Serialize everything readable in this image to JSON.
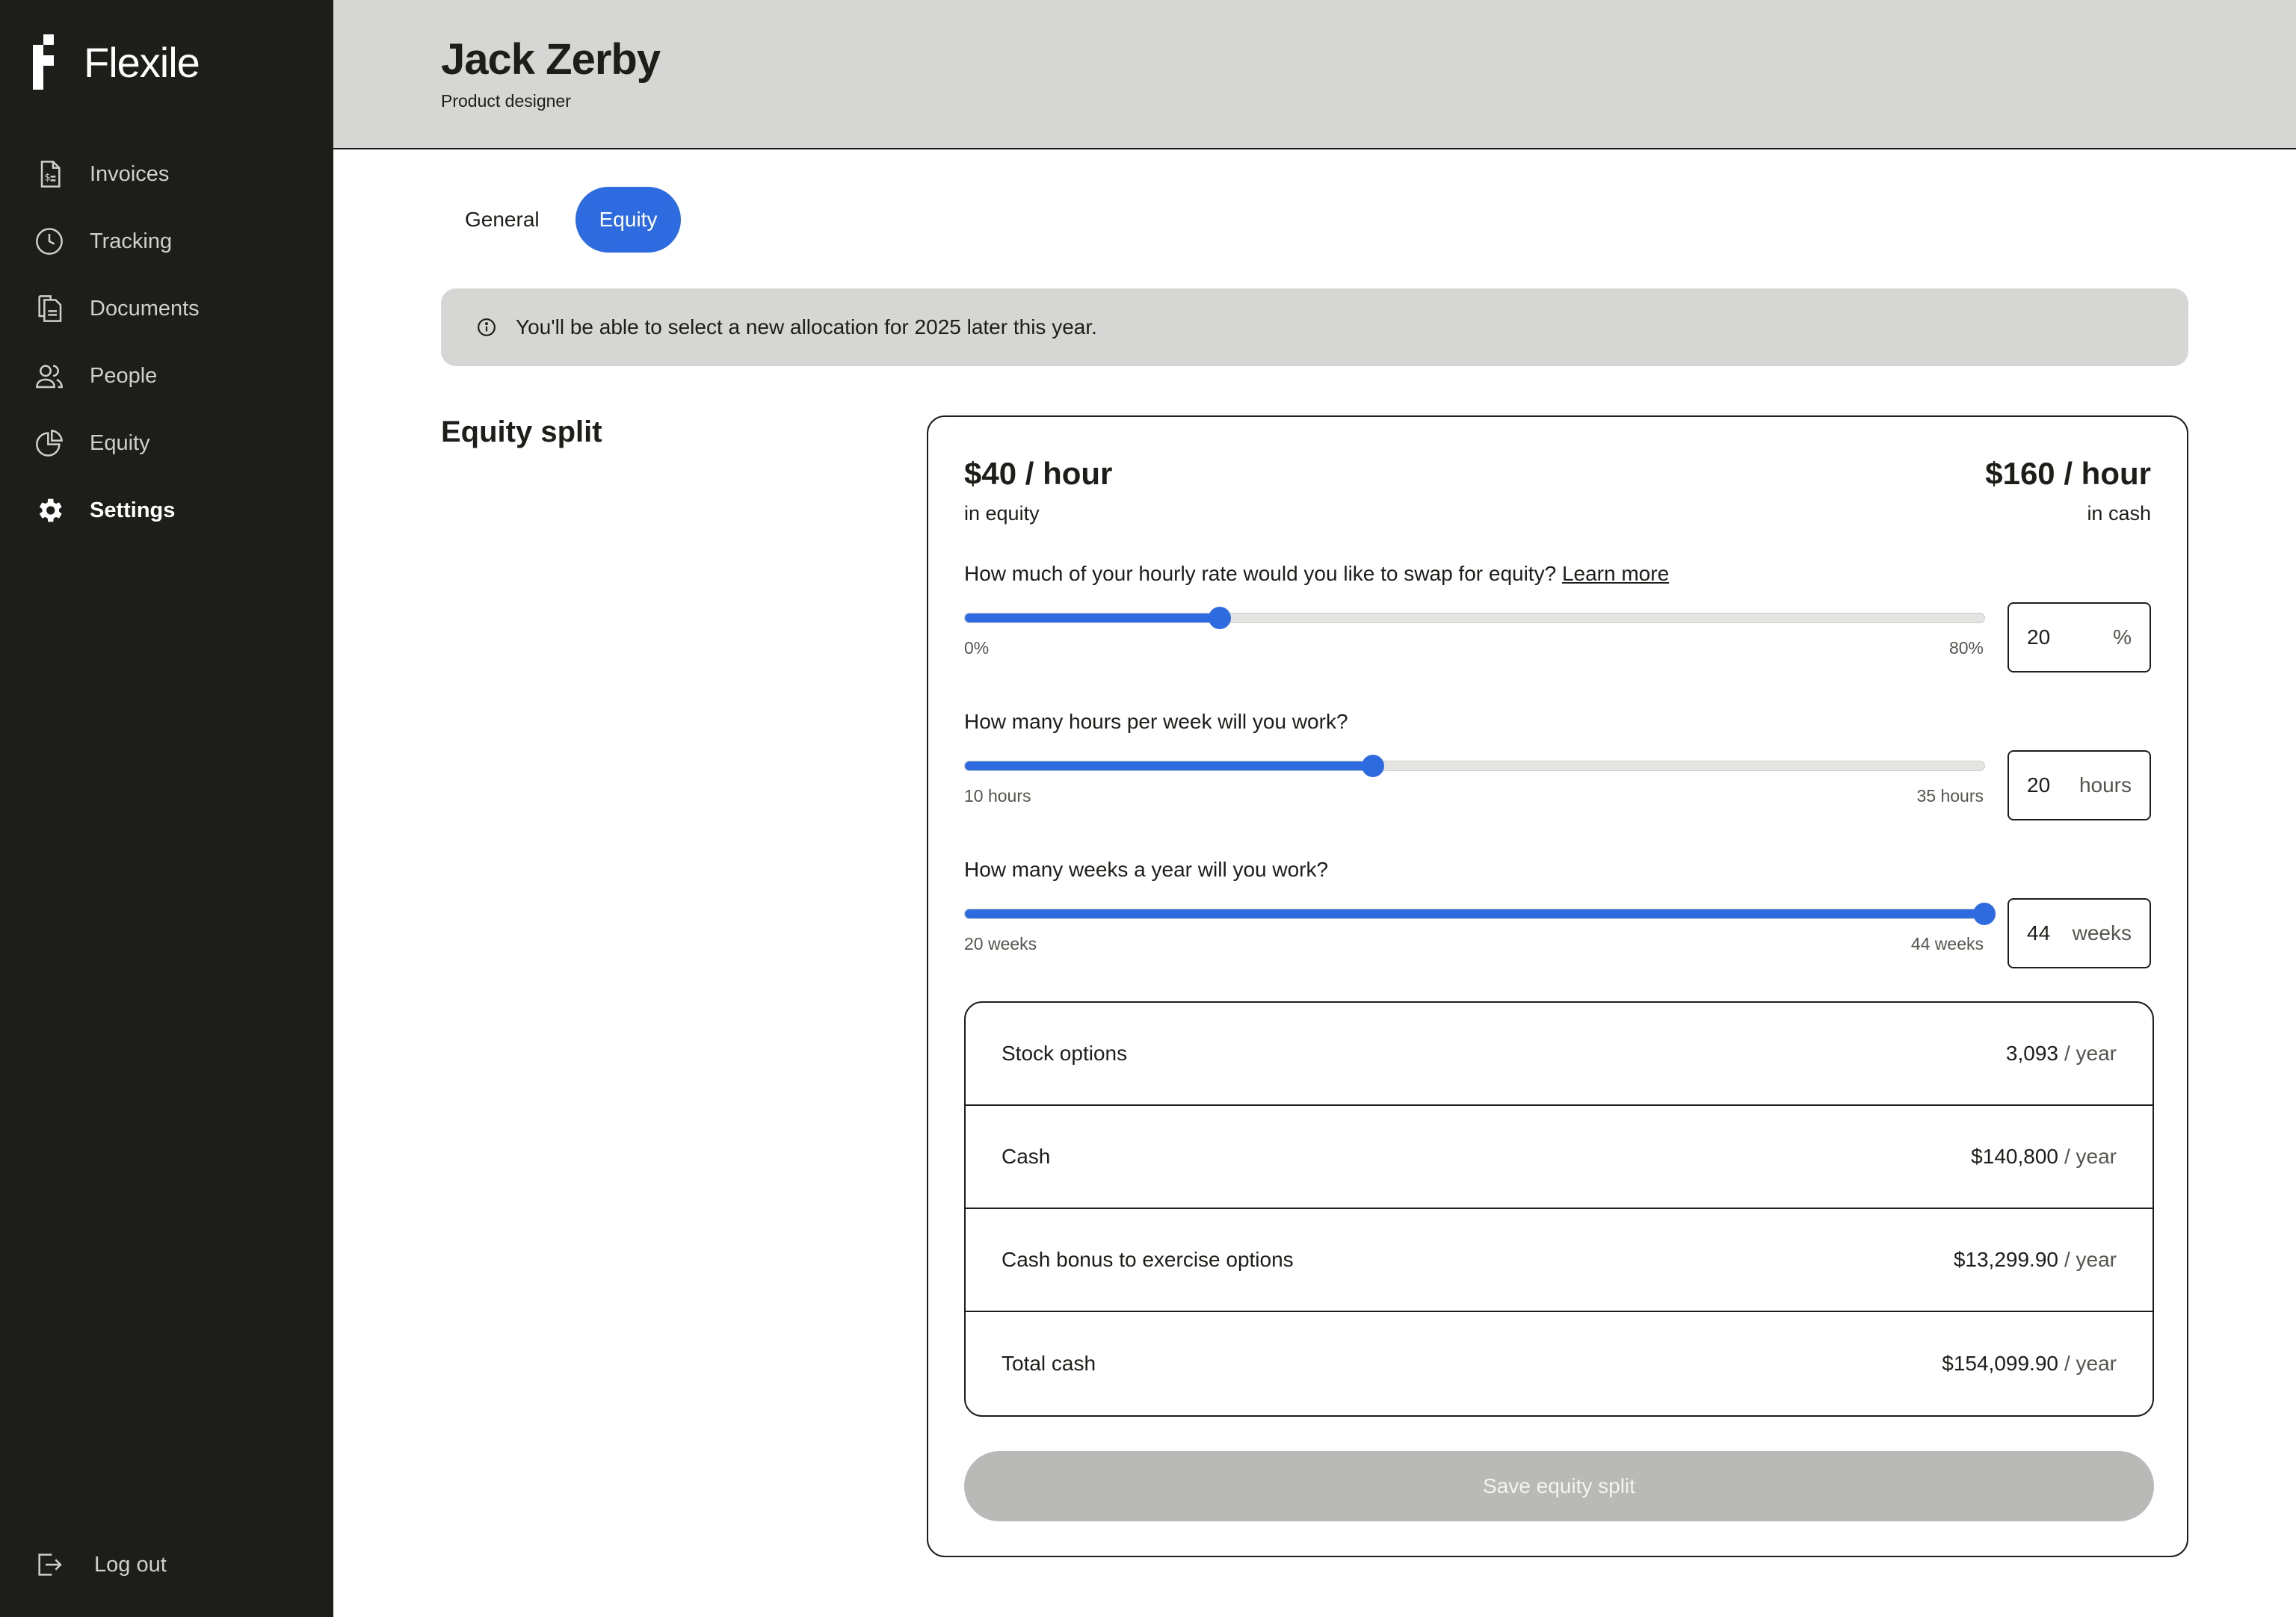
{
  "sidebar": {
    "brand": "Flexile",
    "items": [
      {
        "label": "Invoices",
        "icon": "invoice-icon"
      },
      {
        "label": "Tracking",
        "icon": "clock-icon"
      },
      {
        "label": "Documents",
        "icon": "documents-icon"
      },
      {
        "label": "People",
        "icon": "people-icon"
      },
      {
        "label": "Equity",
        "icon": "pie-chart-icon"
      },
      {
        "label": "Settings",
        "icon": "gear-icon",
        "active": true
      }
    ],
    "logout": "Log out"
  },
  "header": {
    "title": "Jack Zerby",
    "subtitle": "Product designer"
  },
  "tabs": [
    {
      "label": "General",
      "active": false
    },
    {
      "label": "Equity",
      "active": true
    }
  ],
  "notice": {
    "icon": "info-icon",
    "text": "You'll be able to select a new allocation for 2025 later this year."
  },
  "section_title": "Equity split",
  "rates": {
    "equity_value": "$40 / hour",
    "equity_label": "in equity",
    "cash_value": "$160 / hour",
    "cash_label": "in cash"
  },
  "sliders": [
    {
      "question": "How much of your hourly rate would you like to swap for equity?",
      "link": "Learn more",
      "min_label": "0%",
      "max_label": "80%",
      "min": 0,
      "max": 80,
      "value": 20,
      "input_value": "20",
      "unit": "%"
    },
    {
      "question": "How many hours per week will you work?",
      "min_label": "10 hours",
      "max_label": "35 hours",
      "min": 10,
      "max": 35,
      "value": 20,
      "input_value": "20",
      "unit": "hours"
    },
    {
      "question": "How many weeks a year will you work?",
      "min_label": "20 weeks",
      "max_label": "44 weeks",
      "min": 20,
      "max": 44,
      "value": 44,
      "input_value": "44",
      "unit": "weeks"
    }
  ],
  "summary": [
    {
      "label": "Stock options",
      "amount": "3,093",
      "per": "/ year"
    },
    {
      "label": "Cash",
      "amount": "$140,800",
      "per": "/ year"
    },
    {
      "label": "Cash bonus to exercise options",
      "amount": "$13,299.90",
      "per": "/ year"
    },
    {
      "label": "Total cash",
      "amount": "$154,099.90",
      "per": "/ year"
    }
  ],
  "save_button": "Save equity split",
  "colors": {
    "sidebar_bg": "#1d1e19",
    "accent": "#2f6be0",
    "header_bg": "#d6d6d4",
    "disabled_button": "#b9b9b7"
  }
}
